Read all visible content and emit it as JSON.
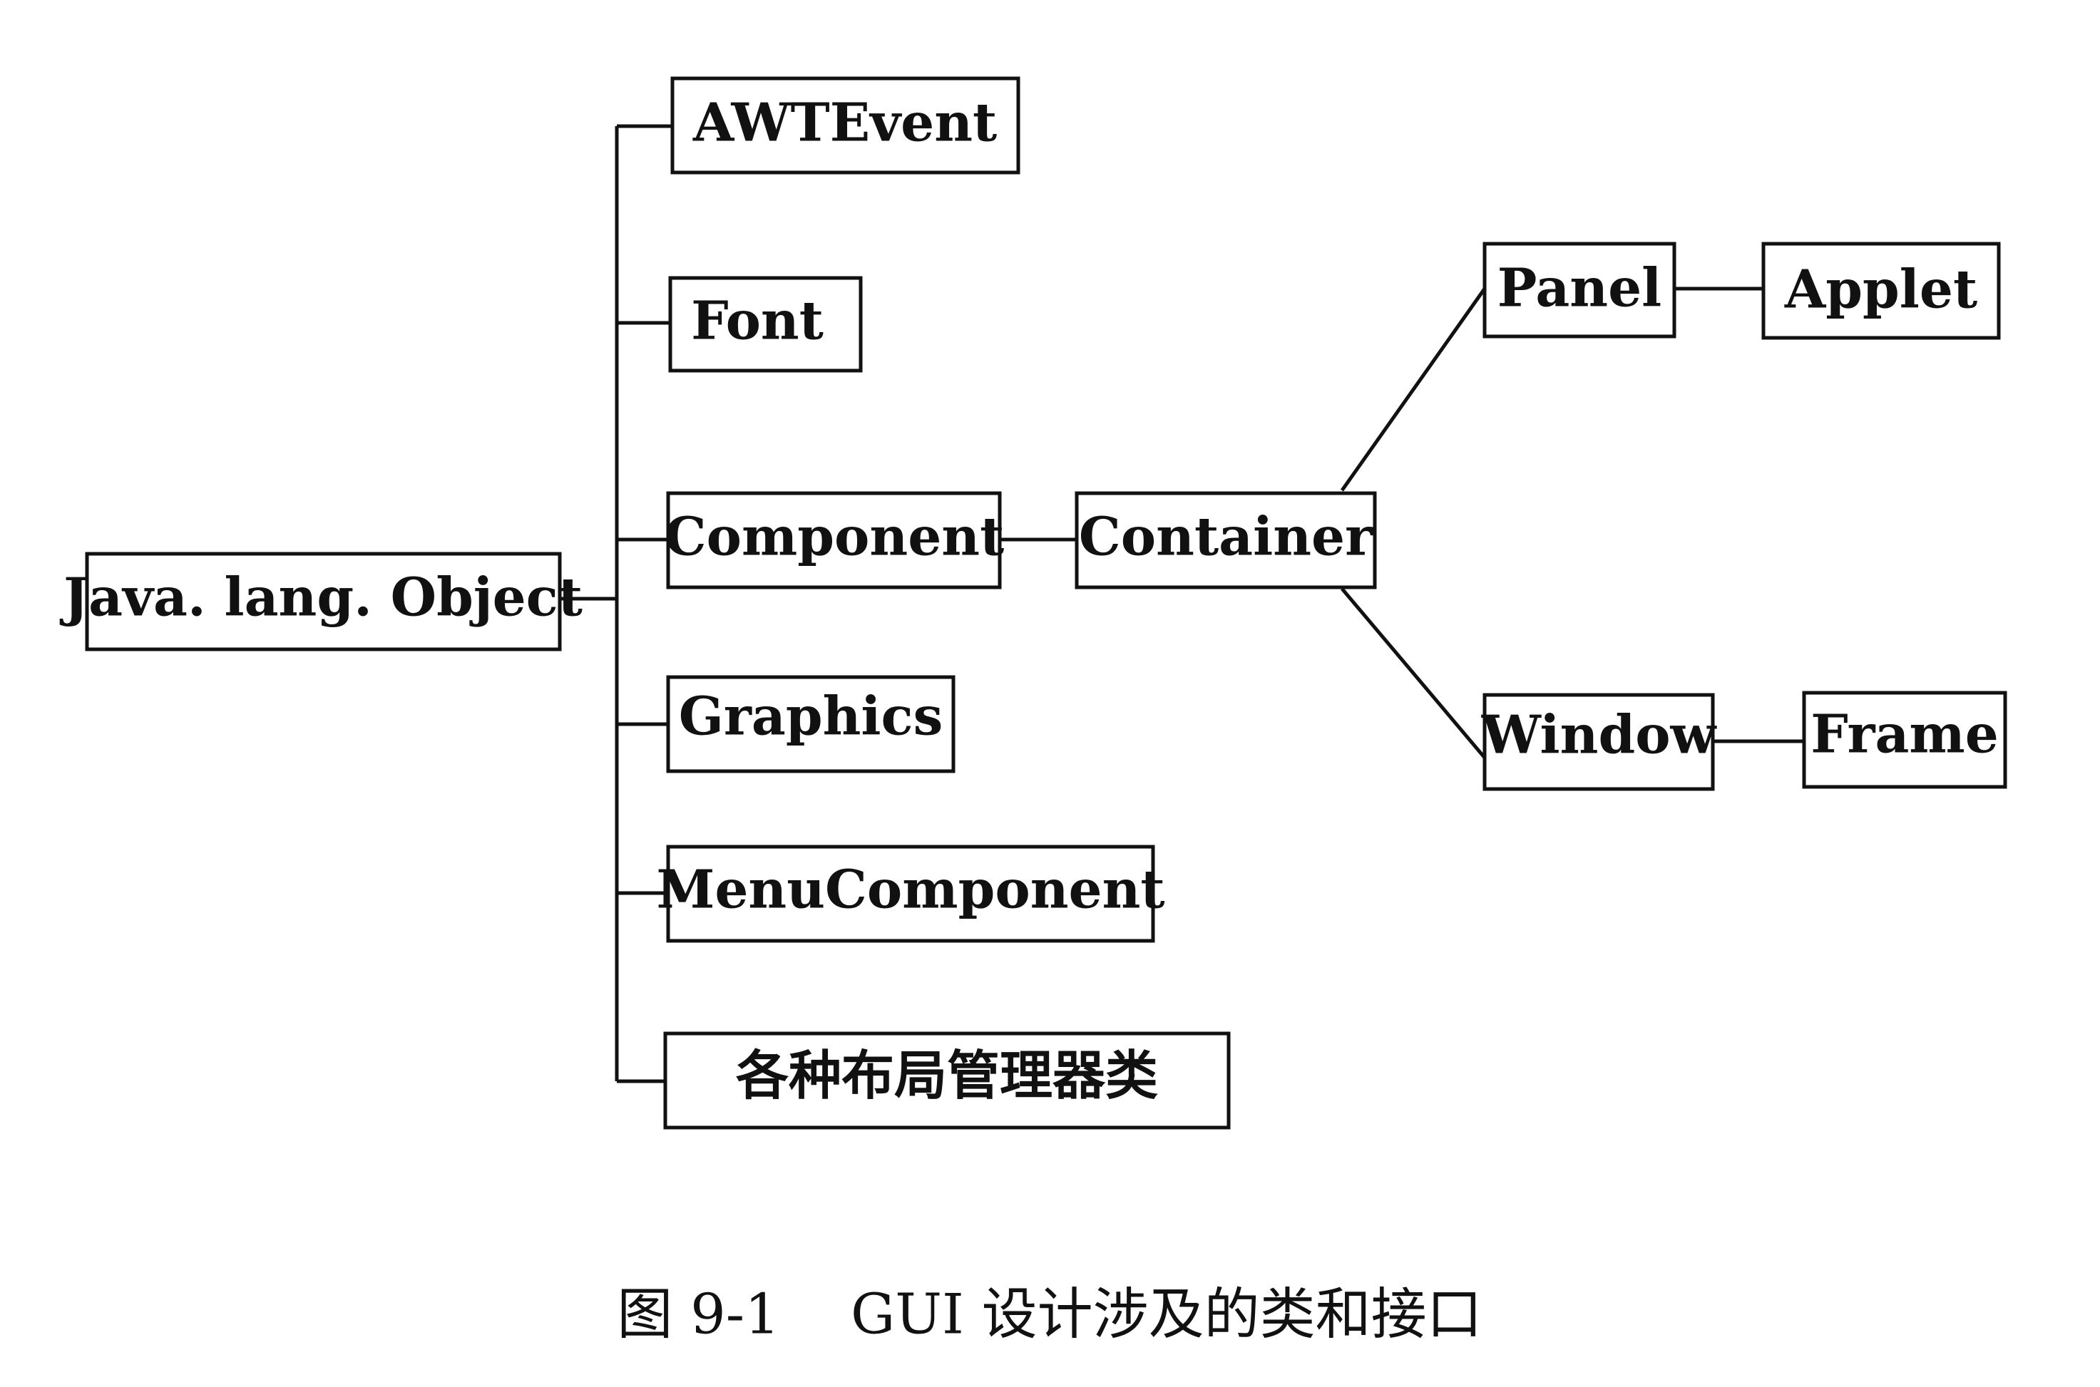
{
  "diagram": {
    "nodes": {
      "object": "Java. lang. Object",
      "awtevent": "AWTEvent",
      "font": "Font",
      "component": "Component",
      "graphics": "Graphics",
      "menucomponent": "MenuComponent",
      "layout": "各种布局管理器类",
      "container": "Container",
      "panel": "Panel",
      "applet": "Applet",
      "window": "Window",
      "frame": "Frame"
    },
    "edges": [
      [
        "object",
        "awtevent"
      ],
      [
        "object",
        "font"
      ],
      [
        "object",
        "component"
      ],
      [
        "object",
        "graphics"
      ],
      [
        "object",
        "menucomponent"
      ],
      [
        "object",
        "layout"
      ],
      [
        "component",
        "container"
      ],
      [
        "container",
        "panel"
      ],
      [
        "container",
        "window"
      ],
      [
        "panel",
        "applet"
      ],
      [
        "window",
        "frame"
      ]
    ]
  },
  "caption": "图 9-1    GUI 设计涉及的类和接口"
}
